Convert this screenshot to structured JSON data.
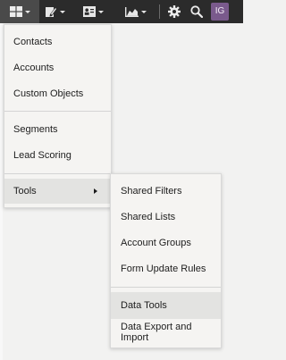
{
  "toolbar": {
    "items": [
      {
        "icon": "grid-icon",
        "has_caret": true,
        "active": true
      },
      {
        "icon": "pencil-icon",
        "has_caret": true,
        "active": false
      },
      {
        "icon": "contact-card-icon",
        "has_caret": true,
        "active": false
      },
      {
        "icon": "chart-icon",
        "has_caret": true,
        "active": false
      }
    ],
    "settings_icon": "gear-icon",
    "search_icon": "search-icon",
    "avatar_initials": "IG"
  },
  "main_menu": {
    "items": [
      {
        "label": "Contacts"
      },
      {
        "label": "Accounts"
      },
      {
        "label": "Custom Objects"
      },
      {
        "label": "Segments"
      },
      {
        "label": "Lead Scoring"
      },
      {
        "label": "Tools"
      }
    ]
  },
  "tools_submenu": {
    "items": [
      {
        "label": "Shared Filters"
      },
      {
        "label": "Shared Lists"
      },
      {
        "label": "Account Groups"
      },
      {
        "label": "Form Update Rules"
      },
      {
        "label": "Data Tools"
      },
      {
        "label": "Data Export and Import"
      }
    ]
  },
  "colors": {
    "toolbar_bg": "#2b2b2b",
    "active_button_bg": "#4a4a4a",
    "menu_bg": "#f5f4f2",
    "hover_bg": "#e3e3e1",
    "avatar_bg": "#7a5a8c"
  }
}
